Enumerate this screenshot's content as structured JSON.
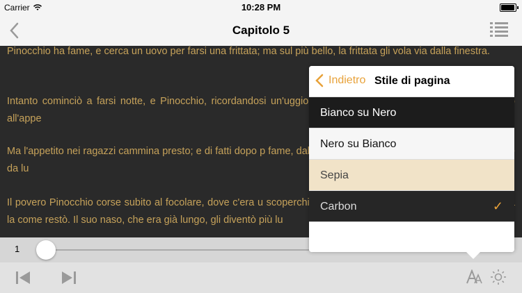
{
  "status": {
    "carrier": "Carrier",
    "time": "10:28 PM"
  },
  "nav": {
    "title": "Capitolo 5"
  },
  "reader": {
    "text_color": "#c6a25a",
    "background": "#2a2a2a",
    "paragraphs": [
      "Pinocchio ha fame, e cerca un uovo per farsi una frittata; ma sul più bello, la frittata gli vola via dalla finestra.",
      "Intanto cominciò a farsi notte, e Pinocchio, ricordandosi un'uggiolina allo stomaco, che somigliava moltissimo all'appe",
      "Ma l'appetito nei ragazzi cammina presto; e di fatti dopo p fame, dal vedere al non vedere, si convertì in una fame da lu",
      "Il povero Pinocchio corse subito al focolare, dove c'era u scoperchiarla, per vedere che cosa ci fosse dentro, ma la come restò. Il suo naso, che era già lungo, gli diventò più lu"
    ]
  },
  "popover": {
    "back_label": "Indietro",
    "title": "Stile di pagina",
    "options": [
      {
        "label": "Bianco su Nero"
      },
      {
        "label": "Nero su Bianco"
      },
      {
        "label": "Sepia"
      },
      {
        "label": "Carbon",
        "selected": true
      }
    ],
    "accent": "#e8a23a"
  },
  "slider": {
    "page": "1",
    "position": 0.0
  },
  "toolbar": {
    "icons": [
      "skip-back-icon",
      "skip-forward-icon",
      "font-size-icon",
      "brightness-icon"
    ]
  }
}
